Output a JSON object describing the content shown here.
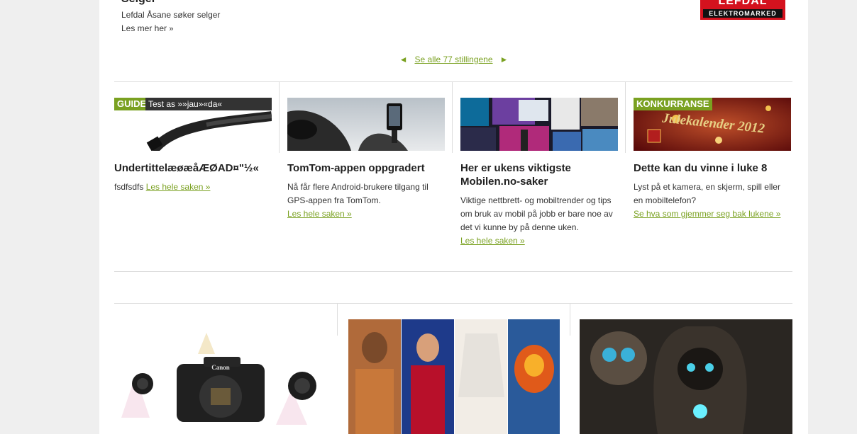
{
  "job": {
    "title": "Selger",
    "description": "Lefdal Åsane søker selger",
    "more_label": "Les mer her",
    "more_arrow": "»",
    "logo_top": "LEFDAL",
    "logo_bottom": "ELEKTROMARKED"
  },
  "pager": {
    "prev_arrow": "◄",
    "label": "Se alle 77 stillingene",
    "next_arrow": "►"
  },
  "articles": [
    {
      "tag": "GUIDE",
      "tag_caption": "Test as »»jau»«da«",
      "title": "UndertittelæøæåÆØAD¤\"½«",
      "body": "fsdfsdfs",
      "link": "Les hele saken »"
    },
    {
      "tag": "",
      "tag_caption": "",
      "title": "TomTom-appen oppgradert",
      "body": "Nå får flere Android-brukere tilgang til GPS-appen fra TomTom.",
      "link": "Les hele saken »"
    },
    {
      "tag": "",
      "tag_caption": "",
      "title": "Her er ukens viktigste Mobilen.no-saker",
      "body": "Viktige nettbrett- og mobiltrender og tips om bruk av mobil på jobb er bare noe av det vi kunne by på denne uken.",
      "link": "Les hele saken »"
    },
    {
      "tag": "KONKURRANSE",
      "tag_caption": "Julekalender 2012",
      "title": "Dette kan du vinne i luke 8",
      "body": "Lyst på et kamera, en skjerm, spill eller en mobiltelefon?",
      "link": "Se hva som gjemmer seg bak lukene »"
    }
  ],
  "bottom": {
    "camera_brand": "Canon"
  },
  "colors": {
    "accent": "#7aa121",
    "brand_red": "#d4121e"
  }
}
